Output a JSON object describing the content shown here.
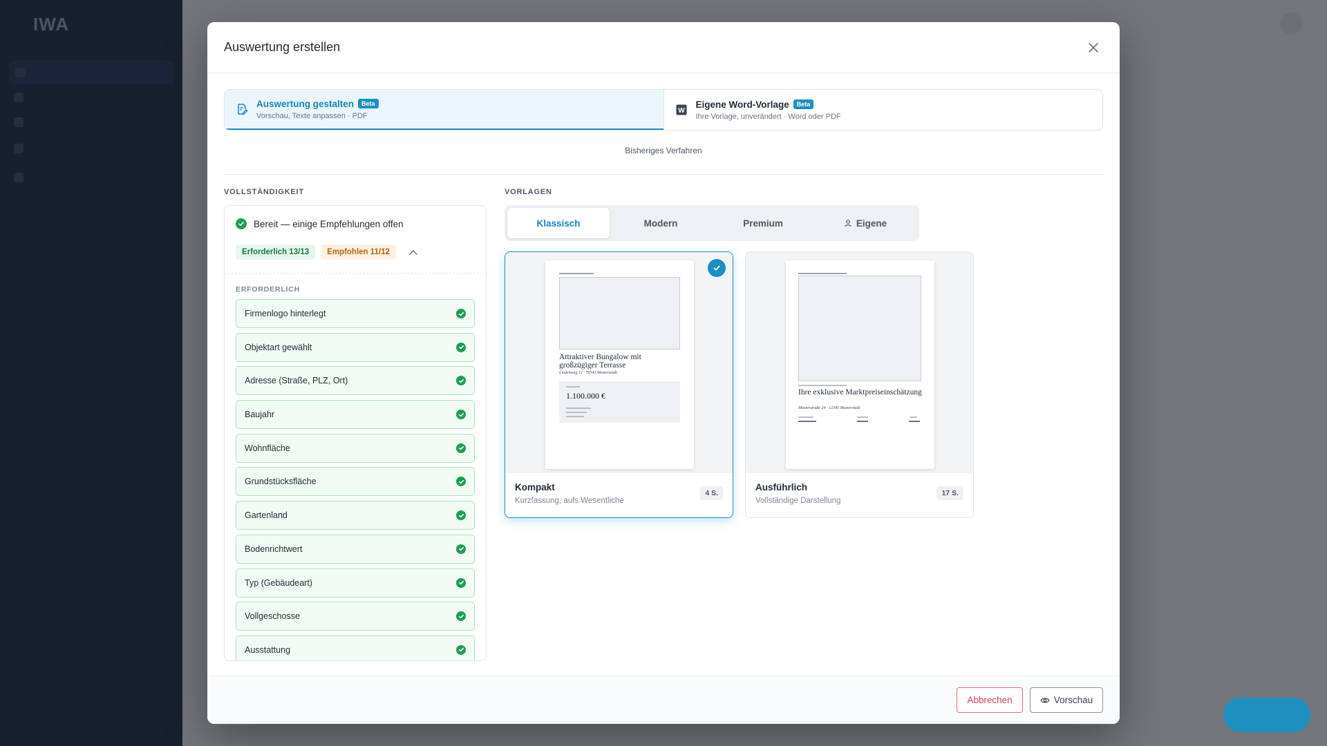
{
  "modal": {
    "title": "Auswertung erstellen",
    "close_icon": "close-icon"
  },
  "modes": [
    {
      "title": "Auswertung gestalten",
      "badge": "Beta",
      "subtitle": "Vorschau, Texte anpassen · PDF",
      "icon": "edit-document-icon",
      "active": true
    },
    {
      "title": "Eigene Word-Vorlage",
      "badge": "Beta",
      "subtitle": "Ihre Vorlage, unverändert · Word oder PDF",
      "icon": "word-icon",
      "active": false
    }
  ],
  "legacy_link": "Bisheriges Verfahren",
  "completeness": {
    "section_label": "VOLLSTÄNDIGKEIT",
    "status": "Bereit — einige Empfehlungen offen",
    "required_pill": "Erforderlich 13/13",
    "recommended_pill": "Empfohlen 11/12",
    "required_label": "ERFORDERLICH",
    "items": [
      "Firmenlogo hinterlegt",
      "Objektart gewählt",
      "Adresse (Straße, PLZ, Ort)",
      "Baujahr",
      "Wohnfläche",
      "Grundstücksfläche",
      "Gartenland",
      "Bodenrichtwert",
      "Typ (Gebäudeart)",
      "Vollgeschosse",
      "Ausstattung"
    ]
  },
  "templates": {
    "section_label": "VORLAGEN",
    "tabs": [
      "Klassisch",
      "Modern",
      "Premium",
      "Eigene"
    ],
    "active_tab": "Klassisch",
    "cards": [
      {
        "name": "Kompakt",
        "desc": "Kurzfassung, aufs Wesentliche",
        "pages": "4 S.",
        "selected": true,
        "preview_title": "Attraktiver Bungalow mit großzügiger Terrasse",
        "preview_address": "Lindenweg 12 · 76543 Musterstadt",
        "preview_price": "1.100.000 €"
      },
      {
        "name": "Ausführlich",
        "desc": "Vollständige Darstellung",
        "pages": "17 S.",
        "selected": false,
        "preview_title": "Ihre exklusive Marktpreiseinschätzung",
        "preview_address": "Musterstraße 24 · 12345 Musterstadt"
      }
    ]
  },
  "footer": {
    "cancel_label": "Abbrechen",
    "preview_label": "Vorschau"
  },
  "colors": {
    "accent": "#1c8fc4",
    "success": "#1f9d57",
    "danger": "#d9405a",
    "sidebar": "#1d2b45"
  }
}
